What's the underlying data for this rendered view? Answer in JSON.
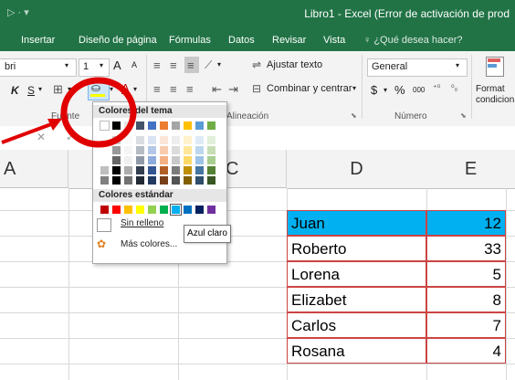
{
  "window": {
    "title": "Libro1 - Excel (Error de activación de prod"
  },
  "tabs": [
    "Insertar",
    "Diseño de página",
    "Fórmulas",
    "Datos",
    "Revisar",
    "Vista"
  ],
  "search": {
    "text": "¿Qué desea hacer?"
  },
  "ribbon": {
    "font_name": "bri",
    "font_size": "1",
    "bold": "K",
    "underline": "S",
    "wrap_text": "Ajustar texto",
    "merge_center": "Combinar y centrar",
    "number_format": "General",
    "currency": "$",
    "percent": "%",
    "thousands": "000",
    "conditional_format": "Format\ncondicion",
    "group_font": "Fuente",
    "group_alignment": "Alineación",
    "group_number": "Número"
  },
  "formula_bar": {
    "cancel": "✕",
    "enter": "✓"
  },
  "columns": [
    "A",
    "C",
    "D",
    "E"
  ],
  "palette": {
    "theme_header": "Colores del tema",
    "standard_header": "Colores estándar",
    "no_fill": "Sin relleno",
    "more_colors": "Más colores...",
    "tooltip": "Azul claro",
    "theme_top": [
      "#ffffff",
      "#000000",
      "#e7e6e6",
      "#44546a",
      "#4472c4",
      "#ed7d31",
      "#a5a5a5",
      "#ffc000",
      "#5b9bd5",
      "#70ad47"
    ],
    "standard": [
      "#c00000",
      "#ff0000",
      "#ffc000",
      "#ffff00",
      "#92d050",
      "#00b050",
      "#00b0f0",
      "#0070c0",
      "#002060",
      "#7030a0"
    ]
  },
  "table": [
    {
      "name": "Juan",
      "value": "12"
    },
    {
      "name": "Roberto",
      "value": "33"
    },
    {
      "name": "Lorena",
      "value": "5"
    },
    {
      "name": "Elizabet",
      "value": "8"
    },
    {
      "name": "Carlos",
      "value": "7"
    },
    {
      "name": "Rosana",
      "value": "4"
    }
  ],
  "colors": {
    "excel_green": "#217346",
    "highlight": "#00b0f0",
    "annotation_red": "#e00000"
  }
}
